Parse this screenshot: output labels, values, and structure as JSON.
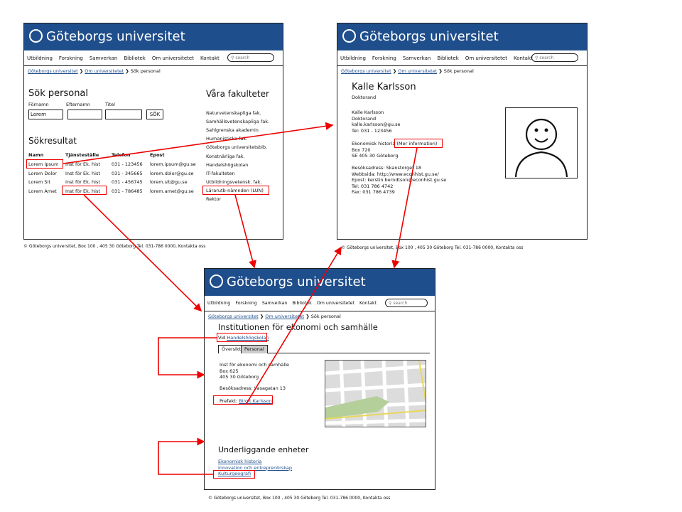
{
  "site_title": "Göteborgs universitet",
  "nav": [
    "Utbildning",
    "Forskning",
    "Samverkan",
    "Bibliotek",
    "Om universitetet",
    "Kontakt"
  ],
  "search_placeholder": "search",
  "breadcrumb": {
    "home": "Göteborgs universitet",
    "about": "Om universitetet",
    "current": "Sök personal"
  },
  "footer": "Göteborgs universitet, Box 100 , 405 30 Göteborg Tel. 031-786 0000, Kontakta oss",
  "search_page": {
    "heading": "Sök personal",
    "labels": {
      "first": "Förnamn",
      "last": "Efternamn",
      "title": "Titel"
    },
    "first_value": "Lorem",
    "button": "SÖK",
    "results_heading": "Sökresultat",
    "columns": [
      "Namn",
      "Tjänsteställe",
      "Telefon",
      "Epost"
    ],
    "rows": [
      [
        "Lorem Ipsum",
        "Inst för Ek. hist",
        "031 - 123456",
        "lorem.ipsum@gu.se"
      ],
      [
        "Lorem Dolor",
        "Inst för Ek. hist",
        "031 - 345665",
        "lorem.dolor@gu.se"
      ],
      [
        "Lorem Sit",
        "Inst för Ek. hist",
        "031 - 456745",
        "lorem.sit@gu.se"
      ],
      [
        "Lorem Amet",
        "Inst för Ek. hist",
        "031 - 786485",
        "lorem.amet@gu.se"
      ]
    ],
    "faculties_heading": "Våra fakulteter",
    "faculties": [
      "Naturvetenskapliga fak.",
      "Samhällsvetenskapliga fak.",
      "Sahlgrenska akademin",
      "Humanistiska fak.",
      "Göteborgs universitetsbib.",
      "Konstnärliga fak.",
      "Handelshögskolan",
      "IT-fakulteten",
      "Utbildningsvetensk. fak.",
      "Lärarutb-nämnden (LUN)",
      "Rektor"
    ]
  },
  "person_page": {
    "name": "Kalle Karlsson",
    "role": "Doktorand",
    "lines": [
      "Kalle Karlsson",
      "Doktorand",
      "kalle.karlsson@gu.se",
      "Tel: 031 - 123456"
    ],
    "dept": "Ekonomisk historia",
    "more": "(Mer information)",
    "address": [
      "Box 720",
      "SE 405 30 Göteborg"
    ],
    "visit": [
      "Besöksadress: Skanstorget 18",
      "Webbsida: http://www.econhist.gu.se/",
      "Epost: kerstin.berndtson@econhist.gu.se",
      "Tel: 031 786 4742",
      "Fax: 031 786 4739"
    ]
  },
  "dept_page": {
    "title": "Institutionen för ekonomi och samhälle",
    "vid": "Vid",
    "school": "Handelshögskolan",
    "tabs": [
      "Översikt",
      "Personal"
    ],
    "address": [
      "Inst för ekonomi och samhälle",
      "Box 625",
      "405 30 Göteborg"
    ],
    "visit": "Besöksadress: Vasagatan 13",
    "prefekt_label": "Prefekt:",
    "prefekt": "Birgit Karlsson",
    "units_heading": "Underliggande enheter",
    "units": [
      "Ekonomisk historia",
      "Innovation och entreprenörskap",
      "Kulturgeografi"
    ]
  }
}
